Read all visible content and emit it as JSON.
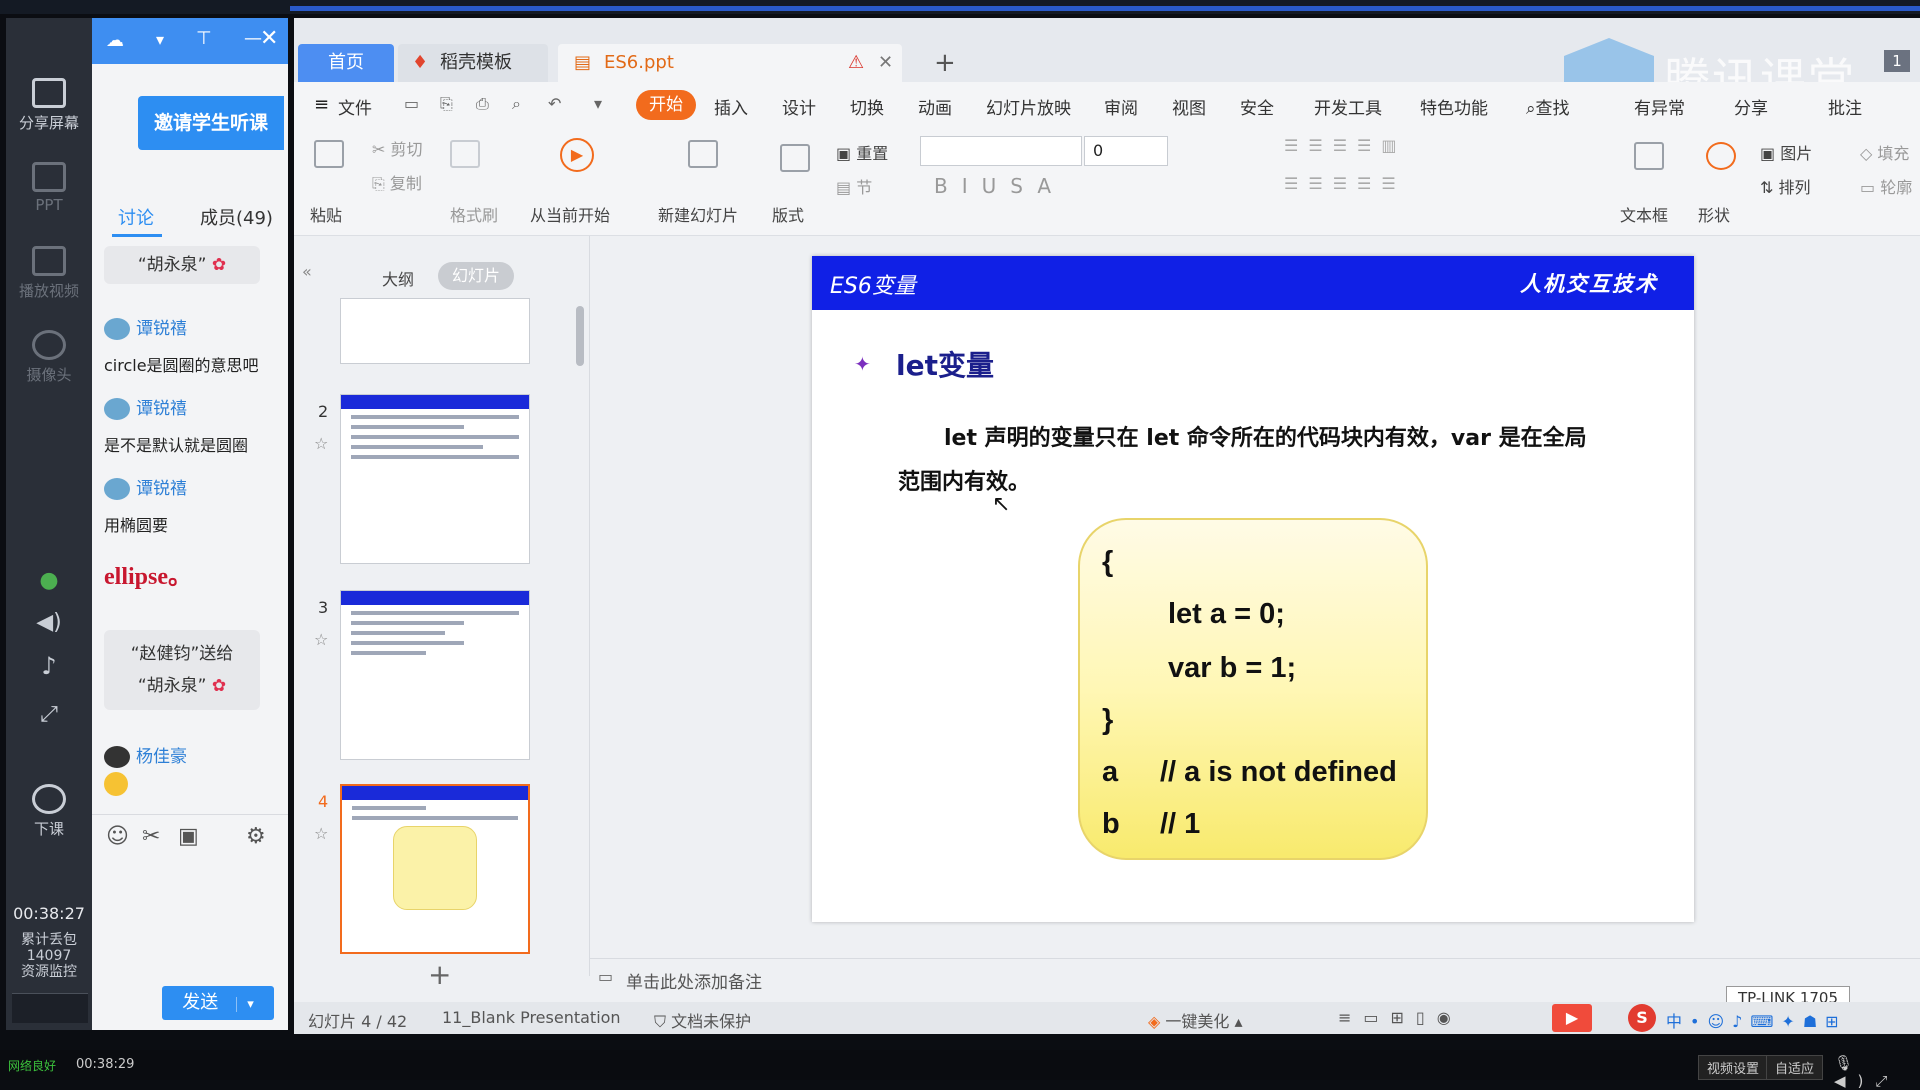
{
  "classroom": {
    "rail": {
      "share_screen": "分享屏幕",
      "ppt": "PPT",
      "play_video": "播放视频",
      "camera": "摄像头",
      "end_class": "下课",
      "timer": "00:38:27",
      "cumulative_label": "累计丢包",
      "cumulative_value": "14097",
      "resource_label": "资源监控"
    },
    "chat": {
      "invite_button": "邀请学生听课",
      "tab_discussion": "讨论",
      "tab_members": "成员(49)",
      "messages": [
        {
          "kind": "gift",
          "text": "“胡永泉”"
        },
        {
          "kind": "user",
          "user": "谭锐禧",
          "text": "circle是圆圈的意思吧"
        },
        {
          "kind": "user",
          "user": "谭锐禧",
          "text": "是不是默认就是圆圈"
        },
        {
          "kind": "user",
          "user": "谭锐禧",
          "text": "用椭圆要"
        },
        {
          "kind": "code",
          "text": "ellipse。"
        },
        {
          "kind": "gift2",
          "line1": "“赵健钧”送给",
          "line2": "“胡永泉”"
        },
        {
          "kind": "user",
          "user": "杨佳豪",
          "text": ""
        }
      ],
      "send_button": "发送"
    },
    "bottom_timer": "00:38:29",
    "net_status": "网络良好",
    "taskbar_buttons": [
      "视频设置",
      "自适应"
    ]
  },
  "app": {
    "tabs": [
      {
        "label": "首页",
        "active": true
      },
      {
        "label": "稻壳模板"
      },
      {
        "label": "ES6.ppt"
      }
    ],
    "watermark": "腾讯课堂",
    "page_badge": "1",
    "menu": [
      "文件",
      "开始",
      "插入",
      "设计",
      "切换",
      "动画",
      "幻灯片放映",
      "审阅",
      "视图",
      "安全",
      "开发工具",
      "特色功能",
      "查找",
      "有异常",
      "分享",
      "批注"
    ],
    "active_menu": "开始",
    "ribbon": {
      "paste": "粘贴",
      "cut": "剪切",
      "copy": "复制",
      "format_painter": "格式刷",
      "from_current": "从当前开始",
      "new_slide": "新建幻灯片",
      "layout": "版式",
      "reset": "重置",
      "section": "节",
      "font_size": "0",
      "textbox": "文本框",
      "shape": "形状",
      "picture": "图片",
      "arrange": "排列",
      "fill": "填充",
      "outline": "轮廓"
    },
    "slide_pane": {
      "tab_outline": "大纲",
      "tab_slides": "幻灯片",
      "numbers": [
        "2",
        "3",
        "4"
      ]
    },
    "slide": {
      "header_left": "ES6变量",
      "header_right": "人机交互技术",
      "heading": "let变量",
      "para1": "let 声明的变量只在 let 命令所在的代码块内有效，var 是在全局",
      "para2": "范围内有效。",
      "code": [
        "{",
        "let a = 0;",
        "var b = 1;",
        "}",
        "a",
        "// a is not defined",
        "b",
        "// 1"
      ]
    },
    "notes_placeholder": "单击此处添加备注",
    "status": {
      "slide_count": "幻灯片 4 / 42",
      "theme": "11_Blank Presentation",
      "protect": "文档未保护",
      "beautify": "一键美化",
      "network_tag": "TP-LINK 1705"
    }
  }
}
